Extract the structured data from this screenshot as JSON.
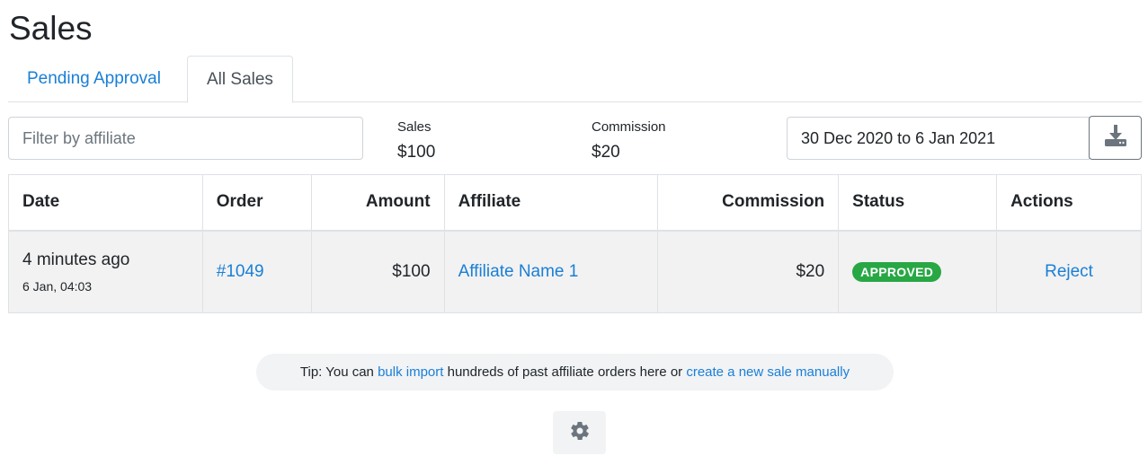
{
  "page": {
    "title": "Sales"
  },
  "tabs": [
    {
      "label": "Pending Approval",
      "active": false
    },
    {
      "label": "All Sales",
      "active": true
    }
  ],
  "filter": {
    "placeholder": "Filter by affiliate",
    "value": ""
  },
  "stats": {
    "sales": {
      "label": "Sales",
      "value": "$100"
    },
    "commission": {
      "label": "Commission",
      "value": "$20"
    }
  },
  "date_range": {
    "value": "30 Dec 2020 to 6 Jan 2021"
  },
  "icons": {
    "download": "download-icon",
    "settings": "gear-icon"
  },
  "table": {
    "headers": [
      "Date",
      "Order",
      "Amount",
      "Affiliate",
      "Commission",
      "Status",
      "Actions"
    ],
    "rows": [
      {
        "time_relative": "4 minutes ago",
        "time_exact": "6 Jan, 04:03",
        "order": "#1049",
        "amount": "$100",
        "affiliate": "Affiliate Name 1",
        "commission": "$20",
        "status": "APPROVED",
        "action": "Reject"
      }
    ]
  },
  "tip": {
    "prefix": "Tip: You can ",
    "link1": "bulk import",
    "middle": " hundreds of past affiliate orders here or ",
    "link2": "create a new sale manually"
  },
  "colors": {
    "link": "#1a7fd6",
    "status_approved": "#28a745",
    "row_background": "#f2f2f2",
    "icon_gray": "#6c757d"
  }
}
